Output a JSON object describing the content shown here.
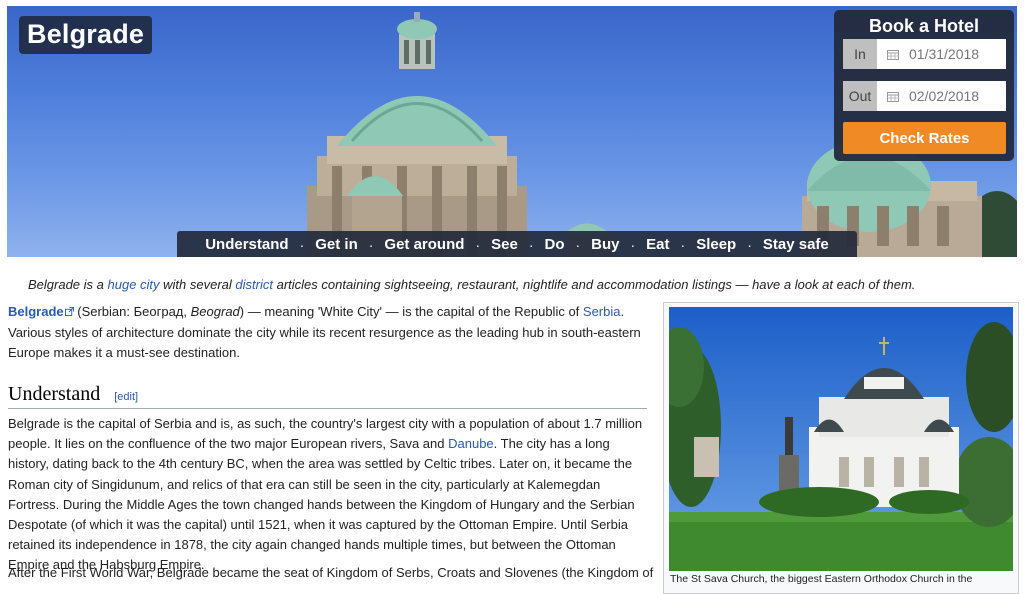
{
  "page": {
    "title": "Belgrade"
  },
  "nav": {
    "items": [
      "Understand",
      "Get in",
      "Get around",
      "See",
      "Do",
      "Buy",
      "Eat",
      "Sleep",
      "Stay safe"
    ],
    "separator": "·"
  },
  "hotel_widget": {
    "title": "Book a Hotel",
    "in_label": "In",
    "in_date": "01/31/2018",
    "out_label": "Out",
    "out_date": "02/02/2018",
    "button_label": "Check Rates",
    "button_color": "#f08a24"
  },
  "intro": {
    "t1": "Belgrade is a ",
    "link1": "huge city",
    "t2": " with several ",
    "link2": "district",
    "t3": " articles containing sightseeing, restaurant, nightlife and accommodation listings — have a look at each of them."
  },
  "lead": {
    "name_link": "Belgrade",
    "t1": " (Serbian: Београд, ",
    "t1_italic": "Beograd",
    "t2": ") — meaning 'White City' — is the capital of the Republic of ",
    "serbia_link": "Serbia",
    "t3": ". Various styles of architecture dominate the city while its recent resurgence as the leading hub in south-eastern Europe makes it a must-see destination."
  },
  "understand": {
    "heading": "Understand",
    "edit_label": "[edit]",
    "p1a": "Belgrade is the capital of Serbia and is, as such, the country's largest city with a population of about 1.7 million people. It lies on the confluence of the two major European rivers, Sava and ",
    "danube_link": "Danube",
    "p1b": ". The city has a long history, dating back to the 4th century BC, when the area was settled by Celtic tribes. Later on, it became the Roman city of Singidunum, and relics of that era can still be seen in the city, particularly at Kalemegdan Fortress. During the Middle Ages the town changed hands between the Kingdom of Hungary and the Serbian Despotate (of which it was the capital) until 1521, when it was captured by the Ottoman Empire. Until Serbia retained its independence in 1878, the city again changed hands multiple times, but between the Ottoman Empire and the Habsburg Empire.",
    "p2": "After the First World War, Belgrade became the seat of Kingdom of Serbs, Croats and Slovenes (the Kingdom of"
  },
  "thumbnail": {
    "caption": "The St Sava Church, the biggest Eastern Orthodox Church in the"
  }
}
